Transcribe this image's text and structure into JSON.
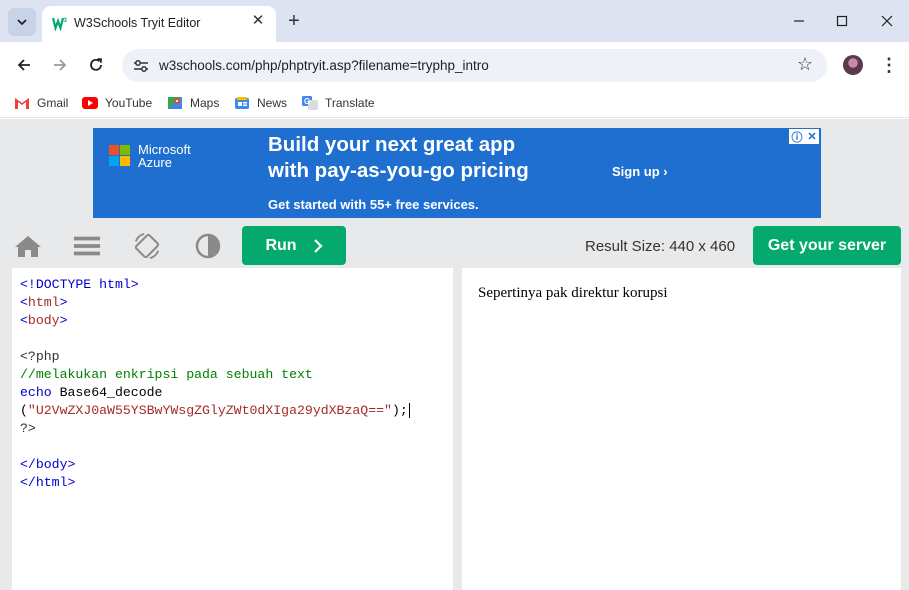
{
  "browser": {
    "tab_title": "W3Schools Tryit Editor",
    "url": "w3schools.com/php/phptryit.asp?filename=tryphp_intro",
    "bookmarks": [
      "Gmail",
      "YouTube",
      "Maps",
      "News",
      "Translate"
    ]
  },
  "ad": {
    "brand_line1": "Microsoft",
    "brand_line2": "Azure",
    "headline_line1": "Build your next great app",
    "headline_line2": "with pay-as-you-go pricing",
    "cta": "Sign up ›",
    "subtext": "Get started with 55+ free services."
  },
  "editor": {
    "run_label": "Run",
    "result_size": "Result Size: 440 x 460",
    "get_server_label": "Get your server"
  },
  "code_lines": [
    "<!DOCTYPE html>",
    "<html>",
    "<body>",
    "",
    "<?php",
    "//melakukan enkripsi pada sebuah text",
    "echo Base64_decode",
    "(\"U2VwZXJ0aW55YSBwYWsgZGlyZWt0dXIga29ydXBzaQ==\");",
    "?>",
    "",
    "</body>",
    "</html>"
  ],
  "code_tokens": {
    "doctype": "<!DOCTYPE html>",
    "html_open": "html",
    "body_open": "body",
    "php_open": "<?php",
    "comment": "//melakukan enkripsi pada sebuah text",
    "echo_kw": "echo",
    "func": " Base64_decode",
    "paren_open": "(",
    "string": "\"U2VwZXJ0aW55YSBwYWsgZGlyZWt0dXIga29ydXBzaQ==\"",
    "paren_close": ");",
    "php_close": "?>",
    "body_close": "/body",
    "html_close": "/html"
  },
  "result": {
    "text": "Sepertinya pak direktur korupsi"
  },
  "colors": {
    "accent_green": "#04aa6d",
    "ad_blue": "#1e6fd0"
  }
}
